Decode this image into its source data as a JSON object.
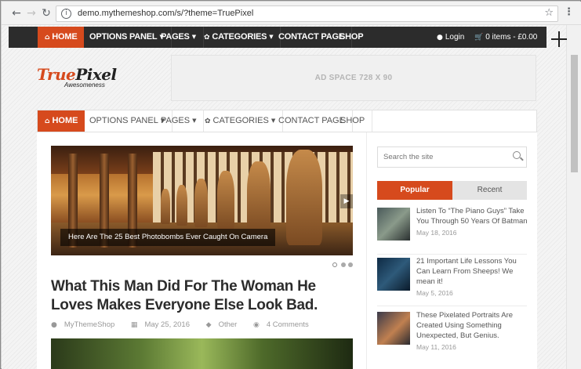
{
  "browser": {
    "url": "demo.mythemeshop.com/s/?theme=TruePixel"
  },
  "top_nav": {
    "items": [
      {
        "label": "HOME",
        "icon": "home-icon",
        "active": true
      },
      {
        "label": "OPTIONS PANEL",
        "has_caret": true
      },
      {
        "label": "PAGES",
        "has_caret": true
      },
      {
        "label": "CATEGORIES",
        "has_caret": true,
        "icon": "leaf-icon"
      },
      {
        "label": "CONTACT PAGE"
      },
      {
        "label": "SHOP"
      }
    ],
    "login": "Login",
    "cart": "0 items - £0.00"
  },
  "header": {
    "logo_true": "True",
    "logo_pixel": "Pixel",
    "tagline": "Awesomeness",
    "ad_space": "AD SPACE 728 X 90"
  },
  "main_nav": {
    "items": [
      {
        "label": "HOME",
        "active": true
      },
      {
        "label": "OPTIONS PANEL"
      },
      {
        "label": "PAGES"
      },
      {
        "label": "CATEGORIES"
      },
      {
        "label": "CONTACT PAGE"
      },
      {
        "label": "SHOP"
      }
    ]
  },
  "featured": {
    "slide_caption": "Here Are The 25 Best Photobombs Ever Caught On Camera",
    "post_title": "What This Man Did For The Woman He Loves Makes Everyone Else Look Bad.",
    "author": "MyThemeShop",
    "date": "May 25, 2016",
    "category": "Other",
    "comments": "4 Comments"
  },
  "sidebar": {
    "search_placeholder": "Search the site",
    "tab_popular": "Popular",
    "tab_recent": "Recent",
    "posts": [
      {
        "title": "Listen To “The Piano Guys” Take You Through 50 Years Of Batman",
        "date": "May 18, 2016"
      },
      {
        "title": "21 Important Life Lessons You Can Learn From Sheeps! We mean it!",
        "date": "May 5, 2016"
      },
      {
        "title": "These Pixelated Portraits Are Created Using Something Unexpected, But Genius.",
        "date": "May 11, 2016"
      }
    ]
  },
  "colors": {
    "accent": "#d64a1d",
    "dark_nav": "#2c2c2c"
  }
}
